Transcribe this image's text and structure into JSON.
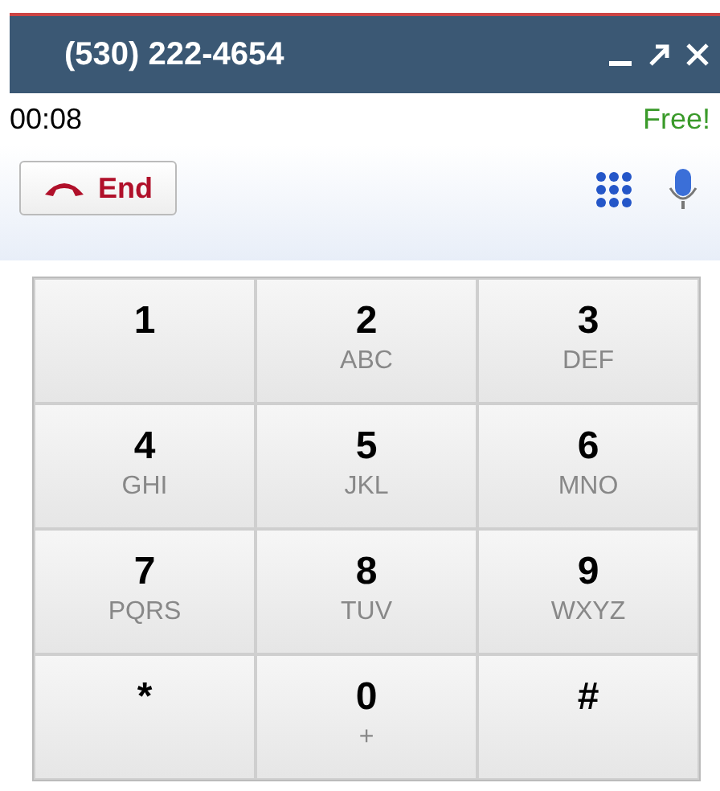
{
  "window": {
    "title": "(530) 222-4654"
  },
  "call": {
    "timer": "00:08",
    "rate": "Free!"
  },
  "end_button": {
    "label": "End"
  },
  "keypad": [
    {
      "digit": "1"
    },
    {
      "digit": "2",
      "letters": "ABC"
    },
    {
      "digit": "3",
      "letters": "DEF"
    },
    {
      "digit": "4",
      "letters": "GHI"
    },
    {
      "digit": "5",
      "letters": "JKL"
    },
    {
      "digit": "6",
      "letters": "MNO"
    },
    {
      "digit": "7",
      "letters": "PQRS"
    },
    {
      "digit": "8",
      "letters": "TUV"
    },
    {
      "digit": "9",
      "letters": "WXYZ"
    },
    {
      "digit": "*"
    },
    {
      "digit": "0",
      "letters": "+"
    },
    {
      "digit": "#"
    }
  ]
}
